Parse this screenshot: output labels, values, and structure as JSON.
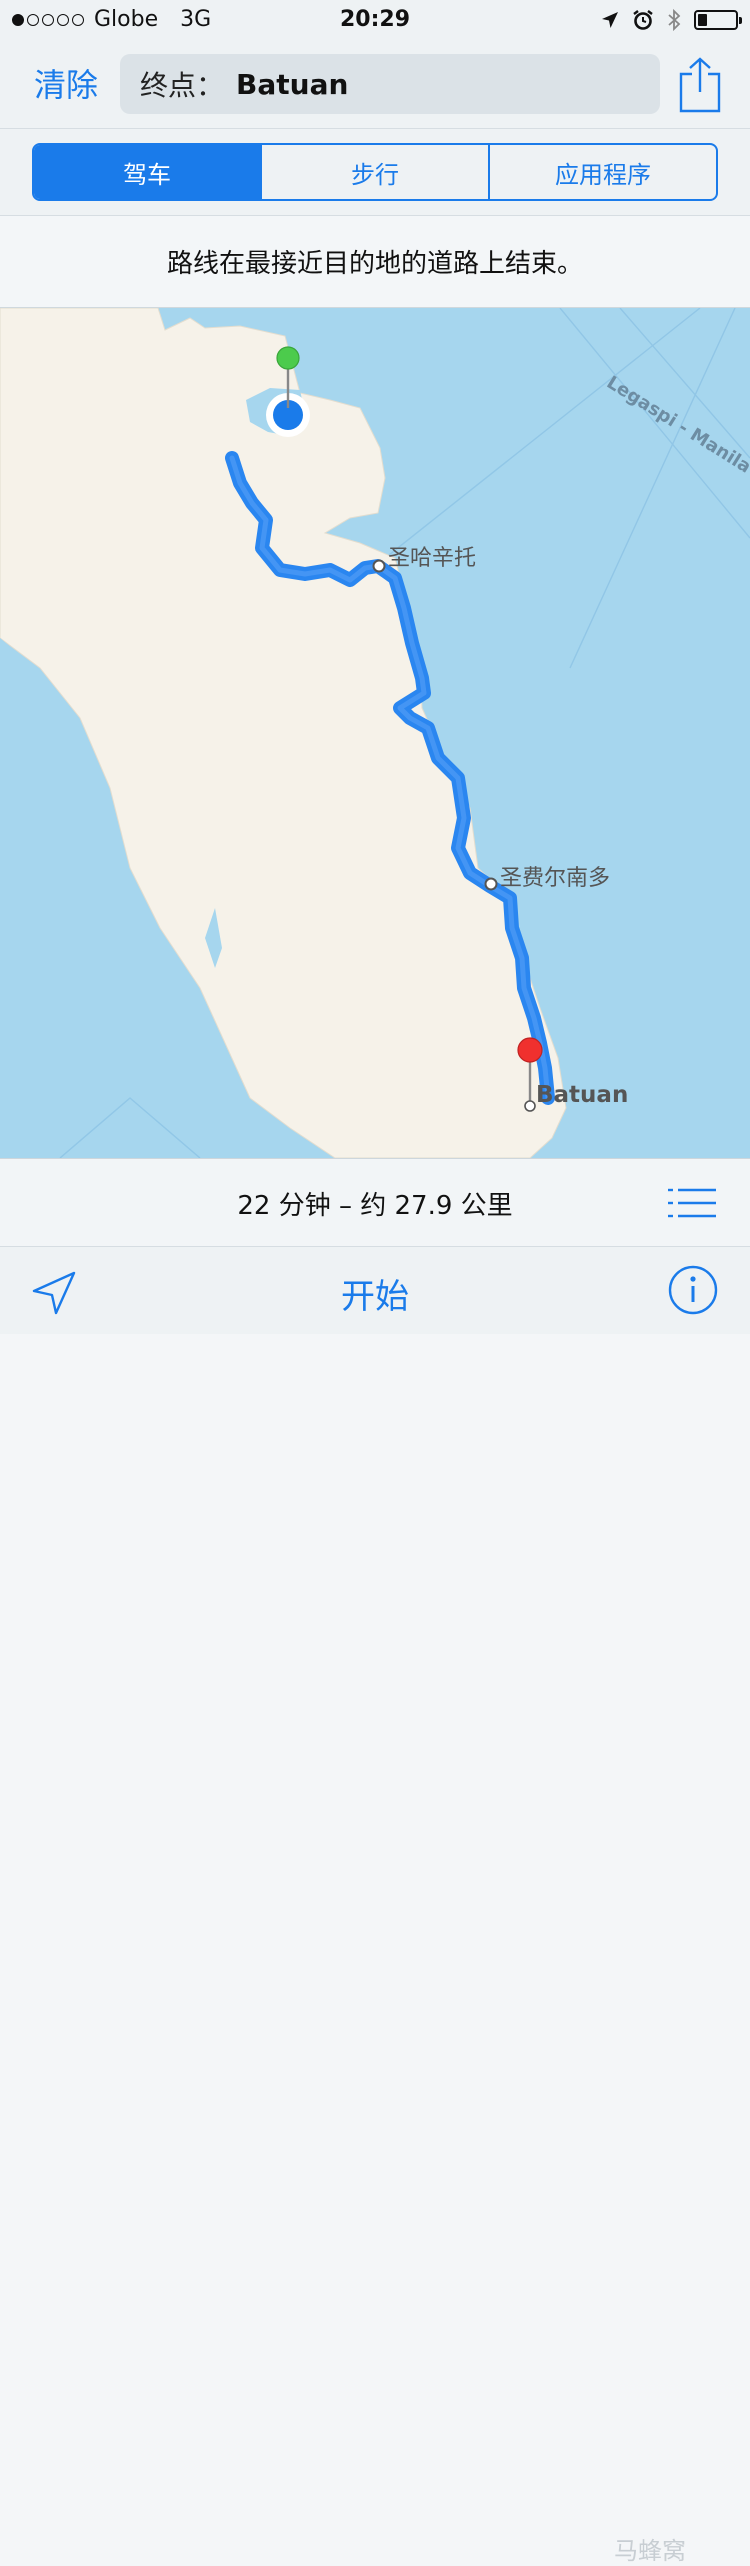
{
  "status_bar": {
    "carrier": "Globe",
    "network": "3G",
    "time": "20:29"
  },
  "nav": {
    "clear_label": "清除",
    "destination_prefix": "终点：",
    "destination_value": "Batuan"
  },
  "modes": [
    {
      "label": "驾车",
      "active": true
    },
    {
      "label": "步行",
      "active": false
    },
    {
      "label": "应用程序",
      "active": false
    }
  ],
  "notice": "路线在最接近目的地的道路上结束。",
  "map": {
    "places": [
      "圣哈辛托",
      "圣费尔南多"
    ],
    "destination_label": "Batuan",
    "sea_route_label": "Legaspi - Manila"
  },
  "route_summary": "22 分钟 – 约 27.9 公里",
  "toolbar": {
    "start_label": "开始"
  },
  "watermark": "马蜂窝",
  "colors": {
    "accent": "#1a7bea",
    "route": "#2a86f0",
    "water": "#a6d6ee",
    "land": "#f6f2e9",
    "start_pin": "#4ccb4c",
    "end_pin": "#f0302e"
  },
  "icons": [
    "location-arrow-icon",
    "alarm-icon",
    "bluetooth-icon",
    "battery-icon",
    "share-icon",
    "list-icon",
    "location-icon",
    "info-icon"
  ]
}
